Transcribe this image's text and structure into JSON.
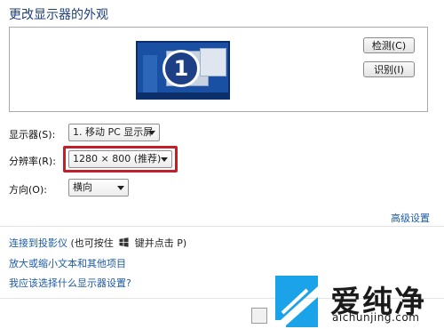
{
  "header": {
    "title": "更改显示器的外观"
  },
  "preview": {
    "monitor_number": "1",
    "detect_label": "检测(C)",
    "identify_label": "识别(I)"
  },
  "settings": {
    "display_label": "显示器(S):",
    "display_value": "1. 移动 PC 显示屏",
    "resolution_label": "分辨率(R):",
    "resolution_value": "1280 × 800 (推荐)",
    "orientation_label": "方向(O):",
    "orientation_value": "横向",
    "advanced_link": "高级设置"
  },
  "links": {
    "projector_link": "连接到投影仪",
    "projector_hint_pre": "(也可按住",
    "projector_hint_post": "键并点击 P)",
    "text_size_link": "放大或缩小文本和其他项目",
    "help_link": "我应该选择什么显示器设置?"
  },
  "watermark": {
    "brand_cn": "爱纯净",
    "brand_url": "aichunjing.com"
  },
  "colors": {
    "accent": "#1d5ba8",
    "highlight": "#c0202a",
    "monitor": "#1a50a3"
  },
  "icons": [
    "windows-key-icon",
    "dropdown-arrow-icon",
    "watermark-logo-icon"
  ]
}
